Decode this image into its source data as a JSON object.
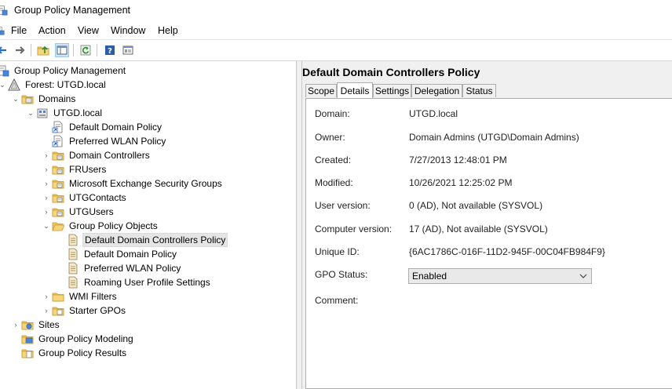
{
  "window": {
    "title": "Group Policy Management"
  },
  "menu": [
    "File",
    "Action",
    "View",
    "Window",
    "Help"
  ],
  "toolbar": {
    "icons": [
      "back-arrow-icon",
      "forward-arrow-icon",
      "up-folder-icon",
      "show-hide-tree-icon",
      "refresh-icon",
      "help-icon",
      "properties-icon"
    ]
  },
  "tree": {
    "root": "Group Policy Management",
    "forest": "Forest: UTGD.local",
    "domains": "Domains",
    "domain": "UTGD.local",
    "default_domain_policy": "Default Domain Policy",
    "preferred_wlan_policy": "Preferred WLAN Policy",
    "domain_controllers": "Domain Controllers",
    "fr_users": "FRUsers",
    "exchange_groups": "Microsoft Exchange Security Groups",
    "utg_contacts": "UTGContacts",
    "utg_users": "UTGUsers",
    "gpo_container": "Group Policy Objects",
    "gpo_items": [
      "Default Domain Controllers Policy",
      "Default Domain Policy",
      "Preferred WLAN Policy",
      "Roaming User Profile Settings"
    ],
    "wmi_filters": "WMI Filters",
    "starter_gpos": "Starter GPOs",
    "sites": "Sites",
    "modeling": "Group Policy Modeling",
    "results": "Group Policy Results"
  },
  "detail": {
    "title": "Default Domain Controllers Policy",
    "tabs": [
      "Scope",
      "Details",
      "Settings",
      "Delegation",
      "Status"
    ],
    "active_tab": "Details",
    "fields": {
      "domain_label": "Domain:",
      "domain_value": "UTGD.local",
      "owner_label": "Owner:",
      "owner_value": "Domain Admins (UTGD\\Domain Admins)",
      "created_label": "Created:",
      "created_value": "7/27/2013 12:48:01 PM",
      "modified_label": "Modified:",
      "modified_value": "10/26/2021 12:25:02 PM",
      "user_version_label": "User version:",
      "user_version_value": "0 (AD), Not available (SYSVOL)",
      "computer_version_label": "Computer version:",
      "computer_version_value": "17 (AD), Not available (SYSVOL)",
      "unique_id_label": "Unique ID:",
      "unique_id_value": "{6AC1786C-016F-11D2-945F-00C04FB984F9}",
      "gpo_status_label": "GPO Status:",
      "gpo_status_value": "Enabled",
      "comment_label": "Comment:"
    }
  },
  "colors": {
    "selection": "#e5e5e5",
    "accent": "#0078d7",
    "folder": "#e8b84a"
  }
}
